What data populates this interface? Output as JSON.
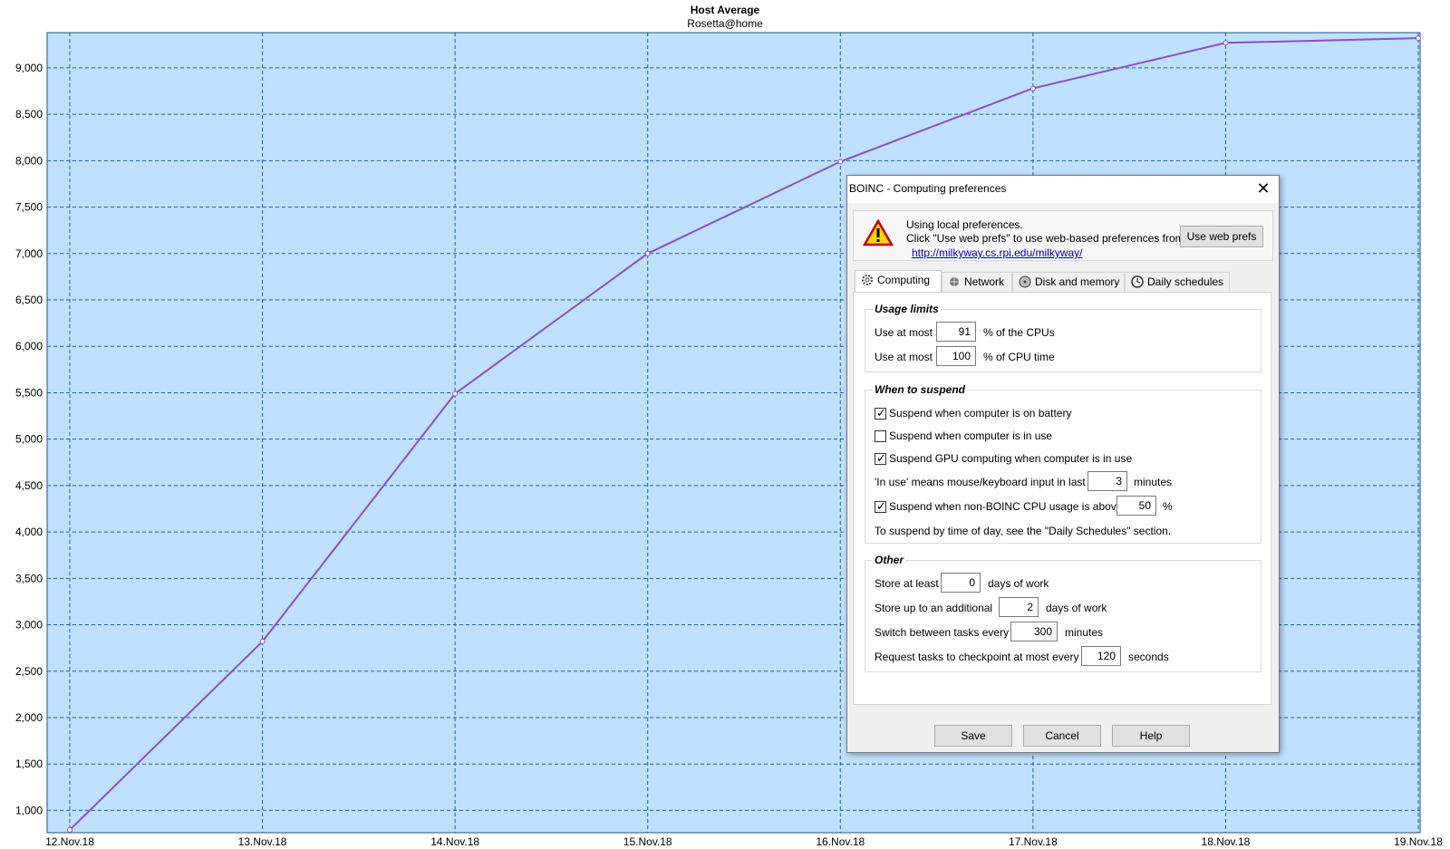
{
  "chart_data": {
    "type": "line",
    "title": "Host Average",
    "subtitle": "Rosetta@home",
    "categories": [
      "12.Nov.18",
      "13.Nov.18",
      "14.Nov.18",
      "15.Nov.18",
      "16.Nov.18",
      "17.Nov.18",
      "18.Nov.18",
      "19.Nov.18"
    ],
    "series": [
      {
        "values": [
          790,
          2820,
          5490,
          7000,
          7990,
          8780,
          9270,
          9320
        ]
      }
    ],
    "ylim": [
      760,
      9380
    ],
    "yticks": [
      1000,
      1500,
      2000,
      2500,
      3000,
      3500,
      4000,
      4500,
      5000,
      5500,
      6000,
      6500,
      7000,
      7500,
      8000,
      8500,
      9000
    ],
    "ytick_labels": [
      "1,000",
      "1,500",
      "2,000",
      "2,500",
      "3,000",
      "3,500",
      "4,000",
      "4,500",
      "5,000",
      "5,500",
      "6,000",
      "6,500",
      "7,000",
      "7,500",
      "8,000",
      "8,500",
      "9,000"
    ],
    "grid": true,
    "colors": {
      "plot_bg": "#bfe0ff",
      "line": "#8a4fc8",
      "grid": "#1f5ea0"
    }
  },
  "dialog": {
    "title": "BOINC - Computing preferences",
    "close_glyph": "✕",
    "notice": {
      "line1": "Using local preferences.",
      "line2": "Click \"Use web prefs\" to use web-based preferences from",
      "link": "http://milkyway.cs.rpi.edu/milkyway/",
      "button": "Use web prefs"
    },
    "tabs": [
      {
        "label": "Computing",
        "icon": "gear-icon"
      },
      {
        "label": "Network",
        "icon": "network-icon"
      },
      {
        "label": "Disk and memory",
        "icon": "disk-icon"
      },
      {
        "label": "Daily schedules",
        "icon": "clock-icon"
      }
    ],
    "usage": {
      "title": "Usage limits",
      "cpus": {
        "prefix": "Use at most",
        "value": "91",
        "suffix": "% of the CPUs"
      },
      "cputime": {
        "prefix": "Use at most",
        "value": "100",
        "suffix": "% of CPU time"
      }
    },
    "suspend": {
      "title": "When to suspend",
      "battery": {
        "label": "Suspend when computer is on battery",
        "checked": true
      },
      "inuse": {
        "label": "Suspend when computer is in use",
        "checked": false
      },
      "gpu": {
        "label": "Suspend GPU computing when computer is in use",
        "checked": true
      },
      "inuse_def": {
        "prefix": "'In use' means mouse/keyboard input in last",
        "value": "3",
        "suffix": "minutes"
      },
      "nonboinc": {
        "label": "Suspend when non-BOINC CPU usage is above",
        "value": "50",
        "suffix": "%",
        "checked": true
      },
      "note": "To suspend by time of day, see the \"Daily Schedules\" section."
    },
    "other": {
      "title": "Other",
      "store_min": {
        "prefix": "Store at least",
        "value": "0",
        "suffix": "days of work"
      },
      "store_add": {
        "prefix": "Store up to an additional",
        "value": "2",
        "suffix": "days of work"
      },
      "switch": {
        "prefix": "Switch between tasks every",
        "value": "300",
        "suffix": "minutes"
      },
      "checkpoint": {
        "prefix": "Request tasks to checkpoint at most every",
        "value": "120",
        "suffix": "seconds"
      }
    },
    "buttons": {
      "save": "Save",
      "cancel": "Cancel",
      "help": "Help"
    }
  }
}
